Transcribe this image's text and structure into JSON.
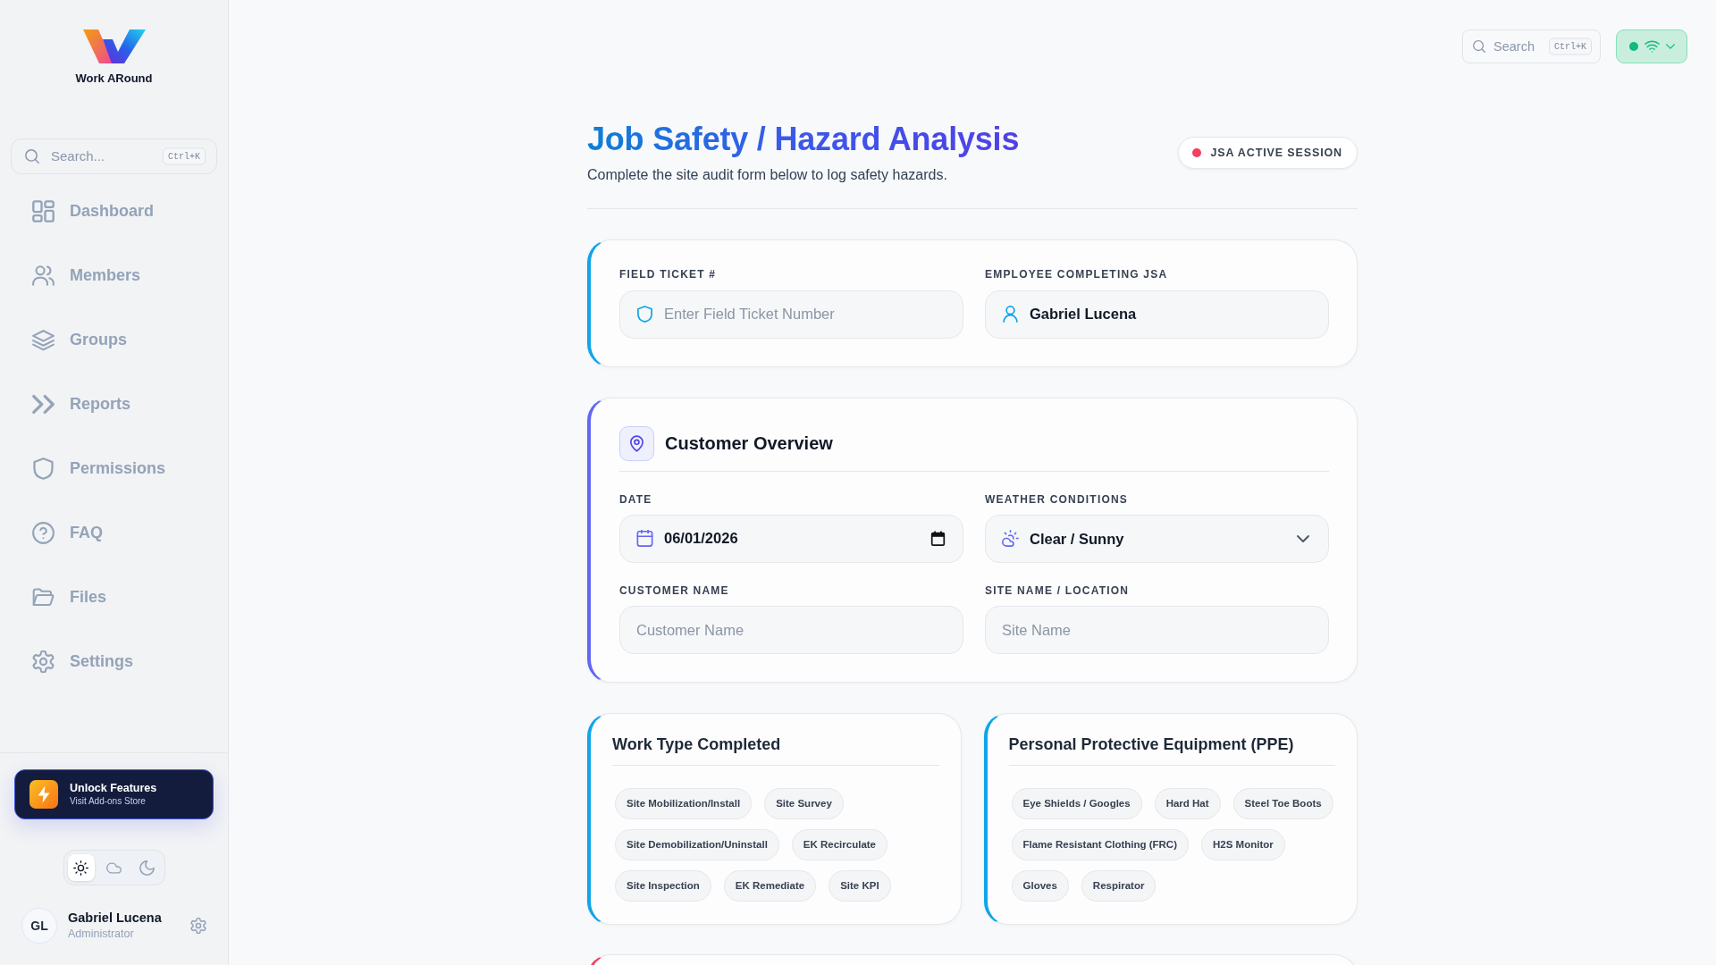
{
  "sidebar": {
    "brand": "Work ARound",
    "search": {
      "placeholder": "Search...",
      "shortcut": "Ctrl+K"
    },
    "nav": [
      {
        "label": "Dashboard",
        "selected": false
      },
      {
        "label": "Members",
        "selected": false
      },
      {
        "label": "Groups",
        "selected": false
      },
      {
        "label": "Reports",
        "selected": false
      },
      {
        "label": "Permissions",
        "selected": false
      },
      {
        "label": "FAQ",
        "selected": false
      },
      {
        "label": "Files",
        "selected": false
      },
      {
        "label": "Settings",
        "selected": false
      }
    ],
    "promo": {
      "title": "Unlock Features",
      "subtitle": "Visit Add-ons Store"
    },
    "theme_toggle": [
      {
        "kind": "light",
        "selected": true
      },
      {
        "kind": "cloudy",
        "selected": false
      },
      {
        "kind": "dark",
        "selected": false
      }
    ],
    "user": {
      "initials": "GL",
      "name": "Gabriel Lucena",
      "role": "Administrator"
    }
  },
  "topbar": {
    "search": {
      "placeholder": "Search",
      "shortcut": "Ctrl+K"
    },
    "connection": {
      "online": true
    }
  },
  "header": {
    "title": "Job Safety / Hazard Analysis",
    "subtitle": "Complete the site audit form below to log safety hazards.",
    "session_badge": "JSA ACTIVE SESSION"
  },
  "ticket_card": {
    "fields": [
      {
        "kind": "ticket",
        "label": "FIELD TICKET #",
        "placeholder": "Enter Field Ticket Number"
      },
      {
        "kind": "person",
        "label": "EMPLOYEE COMPLETING JSA",
        "value": "Gabriel Lucena"
      }
    ]
  },
  "customer_overview": {
    "title": "Customer Overview",
    "fields": [
      {
        "kind": "date",
        "label": "DATE",
        "value": "06/01/2026"
      },
      {
        "kind": "weather",
        "label": "WEATHER CONDITIONS",
        "value": "Clear / Sunny"
      },
      {
        "kind": "text",
        "label": "CUSTOMER NAME",
        "placeholder": "Customer Name"
      },
      {
        "kind": "text",
        "label": "SITE NAME / LOCATION",
        "placeholder": "Site Name"
      }
    ]
  },
  "work_type": {
    "title": "Work Type Completed",
    "options": [
      {
        "label": "Site Mobilization/Install",
        "selected": false
      },
      {
        "label": "Site Survey",
        "selected": false
      },
      {
        "label": "Site Demobilization/Uninstall",
        "selected": false
      },
      {
        "label": "EK Recirculate",
        "selected": false
      },
      {
        "label": "Site Inspection",
        "selected": false
      },
      {
        "label": "EK Remediate",
        "selected": false
      },
      {
        "label": "Site KPI",
        "selected": false
      }
    ]
  },
  "ppe": {
    "title": "Personal Protective Equipment (PPE)",
    "options": [
      {
        "label": "Eye Shields / Googles",
        "selected": false
      },
      {
        "label": "Hard Hat",
        "selected": false
      },
      {
        "label": "Steel Toe Boots",
        "selected": false
      },
      {
        "label": "Flame Resistant Clothing (FRC)",
        "selected": false
      },
      {
        "label": "H2S Monitor",
        "selected": false
      },
      {
        "label": "Gloves",
        "selected": false
      },
      {
        "label": "Respirator",
        "selected": false
      }
    ]
  }
}
